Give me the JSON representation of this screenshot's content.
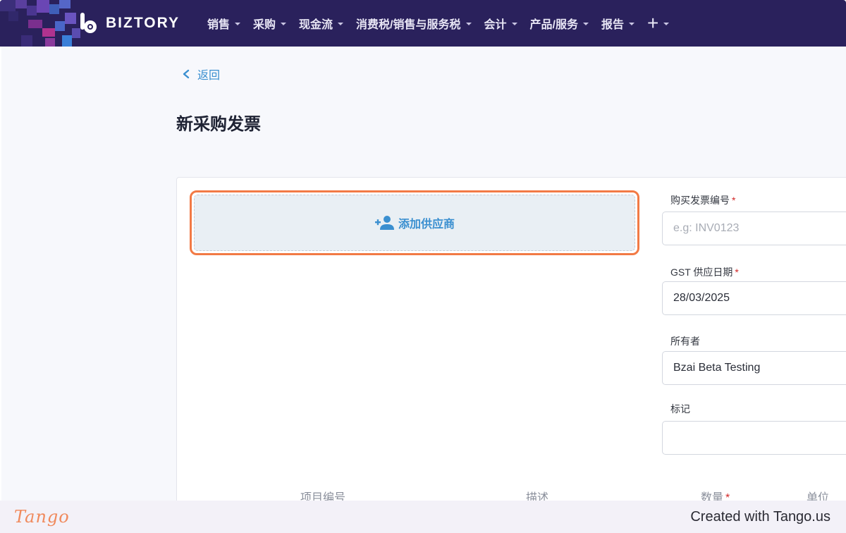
{
  "app": {
    "brand": "BIZTORY"
  },
  "nav": {
    "items": [
      {
        "label": "销售"
      },
      {
        "label": "采购"
      },
      {
        "label": "现金流"
      },
      {
        "label": "消费税/销售与服务税"
      },
      {
        "label": "会计"
      },
      {
        "label": "产品/服务"
      },
      {
        "label": "报告"
      }
    ],
    "plus_label": "+"
  },
  "page": {
    "back_label": "返回",
    "title": "新采购发票"
  },
  "form": {
    "add_supplier_label": "添加供应商",
    "invoice_number": {
      "label": "购买发票编号",
      "required_mark": "*",
      "placeholder": "e.g: INV0123",
      "value": ""
    },
    "gst_date": {
      "label": "GST 供应日期",
      "required_mark": "*",
      "value": "28/03/2025"
    },
    "owner": {
      "label": "所有者",
      "value": "Bzai Beta Testing"
    },
    "tags": {
      "label": "标记",
      "value": ""
    },
    "columns": [
      {
        "label": "项目编号"
      },
      {
        "label": "描述"
      },
      {
        "label": "数量",
        "required_mark": "*"
      },
      {
        "label": "单位"
      }
    ]
  },
  "footer": {
    "tango_logo": "Tango",
    "created_text": "Created with Tango.us"
  },
  "colors": {
    "navbar": "#2a215c",
    "accent_blue": "#3a8fd0",
    "highlight_orange": "#f27a45",
    "required_red": "#d22828"
  },
  "icons": {
    "back": "chevron-left-icon",
    "add_supplier": "add-user-icon",
    "nav_dropdown": "caret-down-icon",
    "logo": "biztory-logo-icon"
  }
}
